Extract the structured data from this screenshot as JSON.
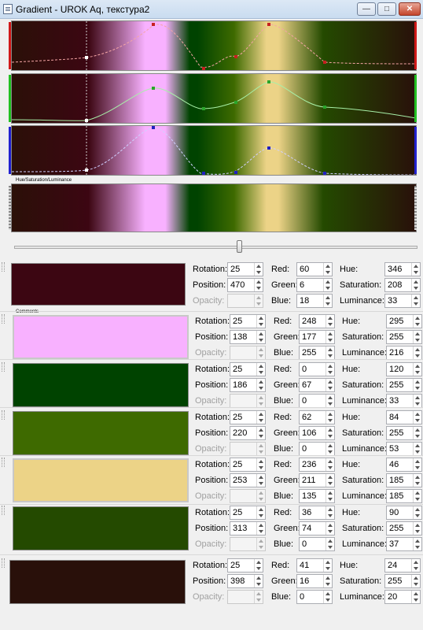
{
  "window": {
    "title": "Gradient - UROK Aq, текстура2",
    "minimize": "—",
    "maximize": "□",
    "close": "✕"
  },
  "hsl_label": "Hue/Saturation/Luminance",
  "comments_label": "Comments",
  "slider": {
    "value": 0.56
  },
  "labels": {
    "rotation": "Rotation:",
    "position": "Position:",
    "opacity": "Opacity:",
    "red": "Red:",
    "green": "Green:",
    "blue": "Blue:",
    "hue": "Hue:",
    "saturation": "Saturation:",
    "luminance": "Luminance:"
  },
  "stops": [
    {
      "color": "#3c0612",
      "rotation": "25",
      "position": "470",
      "opacity": "",
      "red": "60",
      "green": "6",
      "blue": "18",
      "hue": "346",
      "saturation": "208",
      "luminance": "33"
    },
    {
      "color": "#f8b1ff",
      "rotation": "25",
      "position": "138",
      "opacity": "",
      "red": "248",
      "green": "177",
      "blue": "255",
      "hue": "295",
      "saturation": "255",
      "luminance": "216"
    },
    {
      "color": "#004300",
      "rotation": "25",
      "position": "186",
      "opacity": "",
      "red": "0",
      "green": "67",
      "blue": "0",
      "hue": "120",
      "saturation": "255",
      "luminance": "33"
    },
    {
      "color": "#3e6a00",
      "rotation": "25",
      "position": "220",
      "opacity": "",
      "red": "62",
      "green": "106",
      "blue": "0",
      "hue": "84",
      "saturation": "255",
      "luminance": "53"
    },
    {
      "color": "#ecd387",
      "rotation": "25",
      "position": "253",
      "opacity": "",
      "red": "236",
      "green": "211",
      "blue": "135",
      "hue": "46",
      "saturation": "185",
      "luminance": "185"
    },
    {
      "color": "#244a00",
      "rotation": "25",
      "position": "313",
      "opacity": "",
      "red": "36",
      "green": "74",
      "blue": "0",
      "hue": "90",
      "saturation": "255",
      "luminance": "37"
    },
    {
      "color": "#29100a",
      "rotation": "25",
      "position": "398",
      "opacity": "",
      "red": "41",
      "green": "16",
      "blue": "0",
      "hue": "24",
      "saturation": "255",
      "luminance": "20"
    }
  ]
}
